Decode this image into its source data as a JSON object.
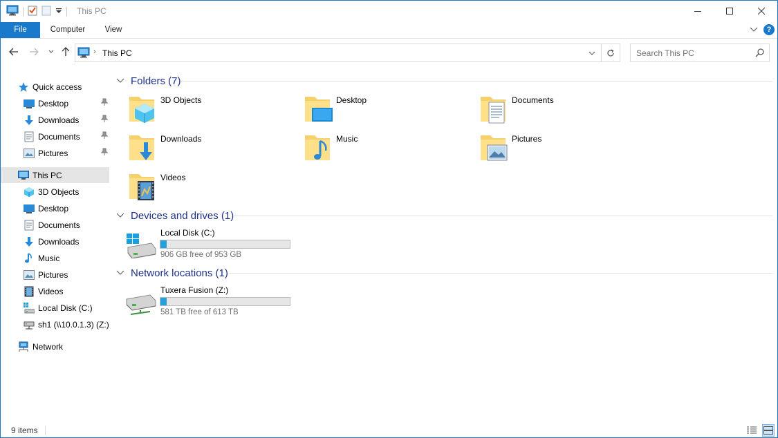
{
  "window": {
    "title": "This PC",
    "accent_color": "#1979ca",
    "quick_access_icons": [
      "computer-icon",
      "properties-check-icon",
      "new-folder-icon",
      "customize-dropdown-icon"
    ],
    "controls": [
      "minimize-icon",
      "maximize-icon",
      "close-icon"
    ]
  },
  "ribbon": {
    "tabs": [
      {
        "label": "File",
        "active": true
      },
      {
        "label": "Computer"
      },
      {
        "label": "View"
      }
    ],
    "help_label": "?"
  },
  "navbar": {
    "address": "This PC",
    "address_separator": "›",
    "search_placeholder": "Search This PC"
  },
  "sidebar": {
    "items": [
      {
        "label": "Quick access",
        "icon": "star-icon",
        "level": 0
      },
      {
        "label": "Desktop",
        "icon": "desktop-icon",
        "level": 1,
        "pinned": true
      },
      {
        "label": "Downloads",
        "icon": "download-arrow-icon",
        "level": 1,
        "pinned": true
      },
      {
        "label": "Documents",
        "icon": "document-icon",
        "level": 1,
        "pinned": true
      },
      {
        "label": "Pictures",
        "icon": "picture-icon",
        "level": 1,
        "pinned": true
      },
      {
        "label": "This PC",
        "icon": "computer-icon",
        "level": 0,
        "selected": true
      },
      {
        "label": "3D Objects",
        "icon": "cube-icon",
        "level": 1
      },
      {
        "label": "Desktop",
        "icon": "desktop-icon",
        "level": 1
      },
      {
        "label": "Documents",
        "icon": "document-icon",
        "level": 1
      },
      {
        "label": "Downloads",
        "icon": "download-arrow-icon",
        "level": 1
      },
      {
        "label": "Music",
        "icon": "music-note-icon",
        "level": 1
      },
      {
        "label": "Pictures",
        "icon": "picture-icon",
        "level": 1
      },
      {
        "label": "Videos",
        "icon": "film-icon",
        "level": 1
      },
      {
        "label": "Local Disk (C:)",
        "icon": "windows-drive-icon",
        "level": 1
      },
      {
        "label": "sh1 (\\\\10.0.1.3) (Z:)",
        "icon": "network-drive-icon",
        "level": 1
      },
      {
        "label": "Network",
        "icon": "network-icon",
        "level": 0
      }
    ]
  },
  "main": {
    "groups": [
      {
        "title": "Folders (7)"
      },
      {
        "title": "Devices and drives (1)"
      },
      {
        "title": "Network locations (1)"
      }
    ],
    "folders": [
      {
        "name": "3D Objects",
        "icon": "cube-icon"
      },
      {
        "name": "Desktop",
        "icon": "desktop-icon"
      },
      {
        "name": "Documents",
        "icon": "document-icon"
      },
      {
        "name": "Downloads",
        "icon": "download-arrow-icon"
      },
      {
        "name": "Music",
        "icon": "music-note-icon"
      },
      {
        "name": "Pictures",
        "icon": "picture-icon"
      },
      {
        "name": "Videos",
        "icon": "film-icon"
      }
    ],
    "drives": [
      {
        "name": "Local Disk (C:)",
        "free": "906 GB free of 953 GB",
        "used_fraction": 0.05,
        "icon": "windows-drive-icon"
      },
      {
        "name": "Tuxera Fusion (Z:)",
        "free": "581 TB free of 613 TB",
        "used_fraction": 0.05,
        "icon": "network-drive-icon"
      }
    ]
  },
  "status": {
    "items_count": "9 items",
    "views": [
      "details-view-icon",
      "large-icons-view-icon"
    ]
  }
}
